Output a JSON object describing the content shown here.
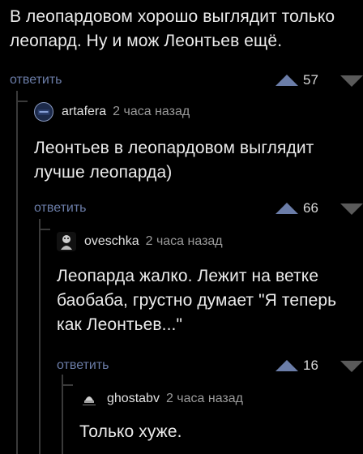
{
  "thread": {
    "root": {
      "text_line1": "В леопардовом хорошо выглядит только",
      "text_line2": "леопард. Ну и мож Леонтьев ещё.",
      "reply_label": "ответить",
      "votes": "57"
    },
    "reply1": {
      "author": "artafera",
      "time": "2 часа назад",
      "text_line1": "Леонтьев в леопардовом выглядит",
      "text_line2": "лучше леопарда)",
      "reply_label": "ответить",
      "votes": "66"
    },
    "reply2": {
      "author": "oveschka",
      "time": "2 часа назад",
      "text_line1": "Леопарда жалко. Лежит на ветке",
      "text_line2": "баобаба, грустно думает \"Я теперь",
      "text_line3": "как Леонтьев...\"",
      "reply_label": "ответить",
      "votes": "16"
    },
    "reply3": {
      "author": "ghostabv",
      "time": "2 часа назад",
      "text_line1": "Только хуже."
    }
  },
  "colors": {
    "background": "#000000",
    "link": "#6b7da8",
    "upvote": "#6b7da8",
    "downvote": "#5a5a5a",
    "thread_line": "#3a3a3a"
  },
  "icons": {
    "upvote": "triangle-up-icon",
    "downvote": "triangle-down-icon",
    "avatar": "user-avatar-icon"
  }
}
